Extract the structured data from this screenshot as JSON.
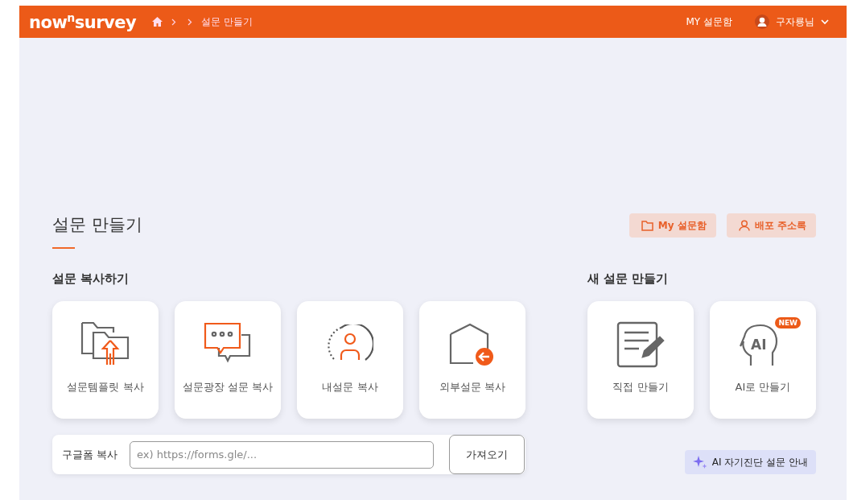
{
  "header": {
    "logo": "now$^{n}$survey",
    "breadcrumb": [
      "설문 만들기"
    ],
    "my_box": "MY 설문함",
    "user": "구자룡님"
  },
  "page": {
    "title": "설문 만들기",
    "buttons": [
      {
        "kind": "folder",
        "label": "My 설문함"
      },
      {
        "kind": "person",
        "label": "배포 주소록"
      }
    ]
  },
  "copy_section": {
    "heading": "설문 복사하기",
    "cards": [
      {
        "kind": "template",
        "label": "설문템플릿 복사"
      },
      {
        "kind": "plaza",
        "label": "설문광장 설문 복사"
      },
      {
        "kind": "mine",
        "label": "내설문 복사"
      },
      {
        "kind": "external",
        "label": "외부설문 복사"
      }
    ],
    "google": {
      "label": "구글폼 복사",
      "placeholder": "ex) https://forms.gle/...",
      "button": "가져오기"
    }
  },
  "new_section": {
    "heading": "새 설문 만들기",
    "cards": [
      {
        "kind": "direct",
        "label": "직접 만들기"
      },
      {
        "kind": "ai",
        "label": "AI로 만들기",
        "badge": "NEW",
        "icon_text": "AI"
      }
    ],
    "guide_button": "AI 자기진단 설문 안내"
  }
}
